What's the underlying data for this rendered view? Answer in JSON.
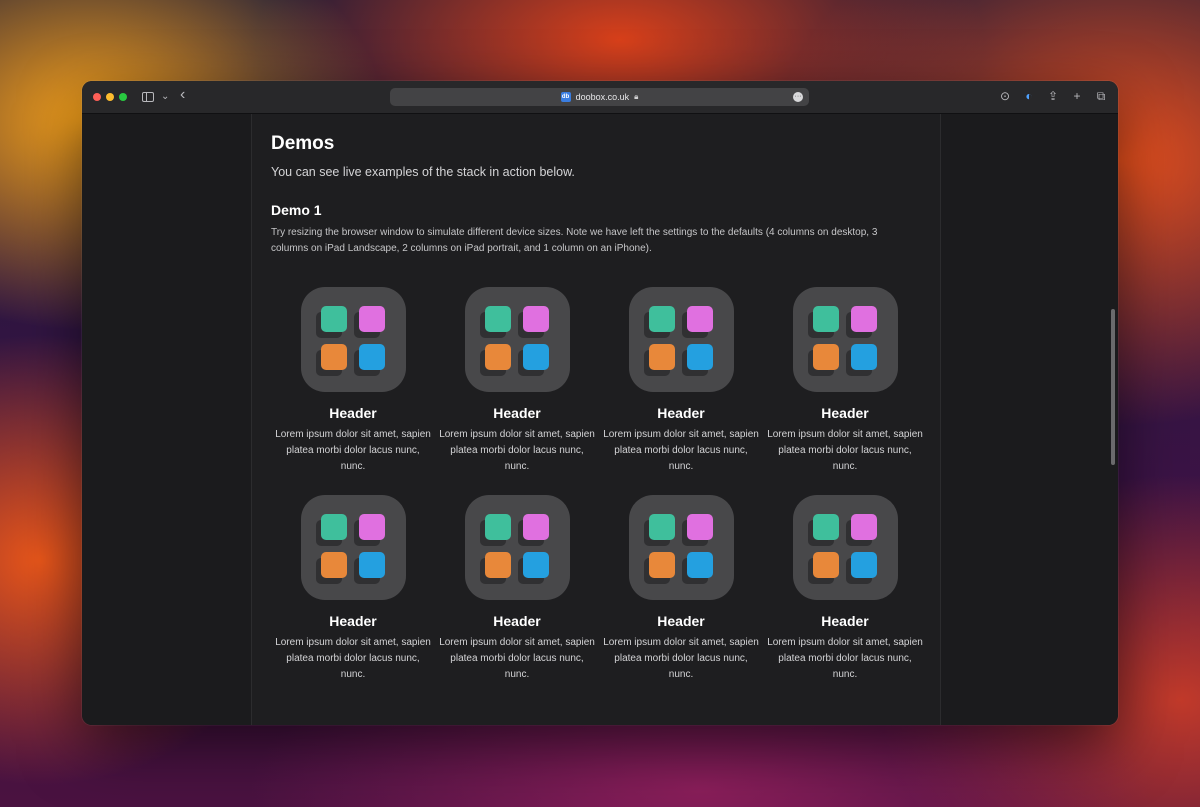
{
  "browser": {
    "url": "doobox.co.uk",
    "favicon_text": "db",
    "icons": [
      "sidebar-icon",
      "chevron-down-icon",
      "back-icon",
      "lock-icon",
      "more-icon",
      "download-icon",
      "extension-icon",
      "share-icon",
      "plus-icon",
      "tabs-icon"
    ]
  },
  "page": {
    "title": "Demos",
    "intro": "You can see live examples of the stack in action below.",
    "demo_title": "Demo 1",
    "demo_description": "Try resizing the browser window to simulate different device sizes. Note we have left the settings to the defaults (4 columns on desktop, 3 columns on iPad Landscape, 2 columns on iPad portrait, and 1 column on an iPhone).",
    "items": [
      {
        "header": "Header",
        "text": "Lorem ipsum dolor sit amet, sapien platea morbi dolor lacus nunc, nunc."
      },
      {
        "header": "Header",
        "text": "Lorem ipsum dolor sit amet, sapien platea morbi dolor lacus nunc, nunc."
      },
      {
        "header": "Header",
        "text": "Lorem ipsum dolor sit amet, sapien platea morbi dolor lacus nunc, nunc."
      },
      {
        "header": "Header",
        "text": "Lorem ipsum dolor sit amet, sapien platea morbi dolor lacus nunc, nunc."
      },
      {
        "header": "Header",
        "text": "Lorem ipsum dolor sit amet, sapien platea morbi dolor lacus nunc, nunc."
      },
      {
        "header": "Header",
        "text": "Lorem ipsum dolor sit amet, sapien platea morbi dolor lacus nunc, nunc."
      },
      {
        "header": "Header",
        "text": "Lorem ipsum dolor sit amet, sapien platea morbi dolor lacus nunc, nunc."
      },
      {
        "header": "Header",
        "text": "Lorem ipsum dolor sit amet, sapien platea morbi dolor lacus nunc, nunc."
      }
    ]
  },
  "colors": {
    "tile_green": "#3fbf9c",
    "tile_pink": "#e070e0",
    "tile_orange": "#e8883a",
    "tile_blue": "#24a0e0"
  }
}
